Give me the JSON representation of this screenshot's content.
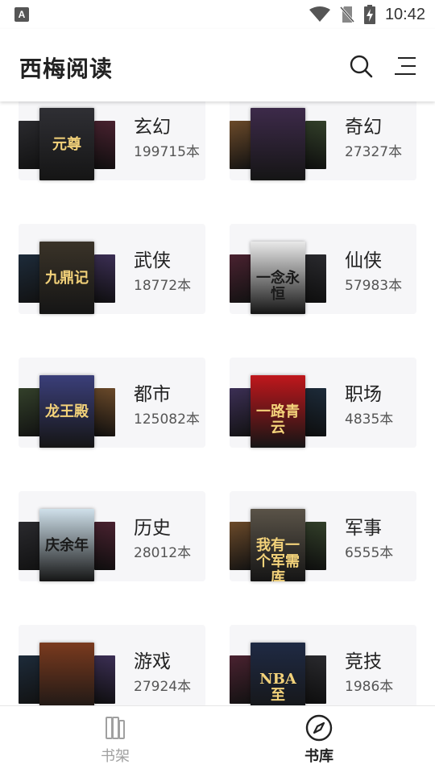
{
  "status_bar": {
    "time": "10:42",
    "notification_icon": "A"
  },
  "app_bar": {
    "title": "西梅阅读",
    "search_icon": "search-icon",
    "menu_icon": "menu-icon"
  },
  "categories": [
    {
      "name": "玄幻",
      "count": "199715本",
      "cover_text": "元尊",
      "cover_color": "#2f2f34"
    },
    {
      "name": "奇幻",
      "count": "27327本",
      "cover_text": "",
      "cover_color": "#3d2a4a"
    },
    {
      "name": "武侠",
      "count": "18772本",
      "cover_text": "九鼎记",
      "cover_color": "#3a3328"
    },
    {
      "name": "仙侠",
      "count": "57983本",
      "cover_text": "一念永恒",
      "cover_color": "#e9e9e9"
    },
    {
      "name": "都市",
      "count": "125082本",
      "cover_text": "龙王殿",
      "cover_color": "#3b3f7a"
    },
    {
      "name": "职场",
      "count": "4835本",
      "cover_text": "一路青云",
      "cover_color": "#c0171c"
    },
    {
      "name": "历史",
      "count": "28012本",
      "cover_text": "庆余年",
      "cover_color": "#cfe0ea"
    },
    {
      "name": "军事",
      "count": "6555本",
      "cover_text": "我有一个军需库",
      "cover_color": "#5a5348"
    },
    {
      "name": "游戏",
      "count": "27924本",
      "cover_text": "",
      "cover_color": "#7a3a1e"
    },
    {
      "name": "竞技",
      "count": "1986本",
      "cover_text": "NBA至",
      "cover_color": "#1f2a44"
    }
  ],
  "bottom_nav": [
    {
      "label": "书架",
      "icon": "bookshelf-icon",
      "active": false
    },
    {
      "label": "书库",
      "icon": "compass-icon",
      "active": true
    }
  ],
  "colors": {
    "accent": "#222222",
    "card_bg": "#f6f6f8",
    "inactive": "#a0a0a0"
  }
}
